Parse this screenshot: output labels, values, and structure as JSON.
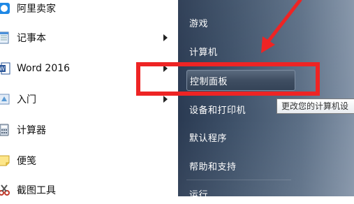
{
  "programs": [
    {
      "label": "阿里卖家",
      "icon": "aliwangwang-icon",
      "has_submenu": false
    },
    {
      "label": "记事本",
      "icon": "notepad-icon",
      "has_submenu": true
    },
    {
      "label": "Word 2016",
      "icon": "word-icon",
      "has_submenu": true
    },
    {
      "label": "入门",
      "icon": "getting-started-icon",
      "has_submenu": true
    },
    {
      "label": "计算器",
      "icon": "calculator-icon",
      "has_submenu": false
    },
    {
      "label": "便笺",
      "icon": "sticky-notes-icon",
      "has_submenu": false
    },
    {
      "label": "截图工具",
      "icon": "snipping-tool-icon",
      "has_submenu": false
    }
  ],
  "system_items": [
    {
      "label": "游戏"
    },
    {
      "label": "计算机"
    },
    {
      "label": "控制面板",
      "active": true
    },
    {
      "label": "设备和打印机"
    },
    {
      "label": "默认程序"
    },
    {
      "label": "帮助和支持"
    },
    {
      "label": "运行"
    }
  ],
  "tooltip": "更改您的计算机设",
  "colors": {
    "annotation": "#ee2424",
    "pane": "#3d5068"
  }
}
